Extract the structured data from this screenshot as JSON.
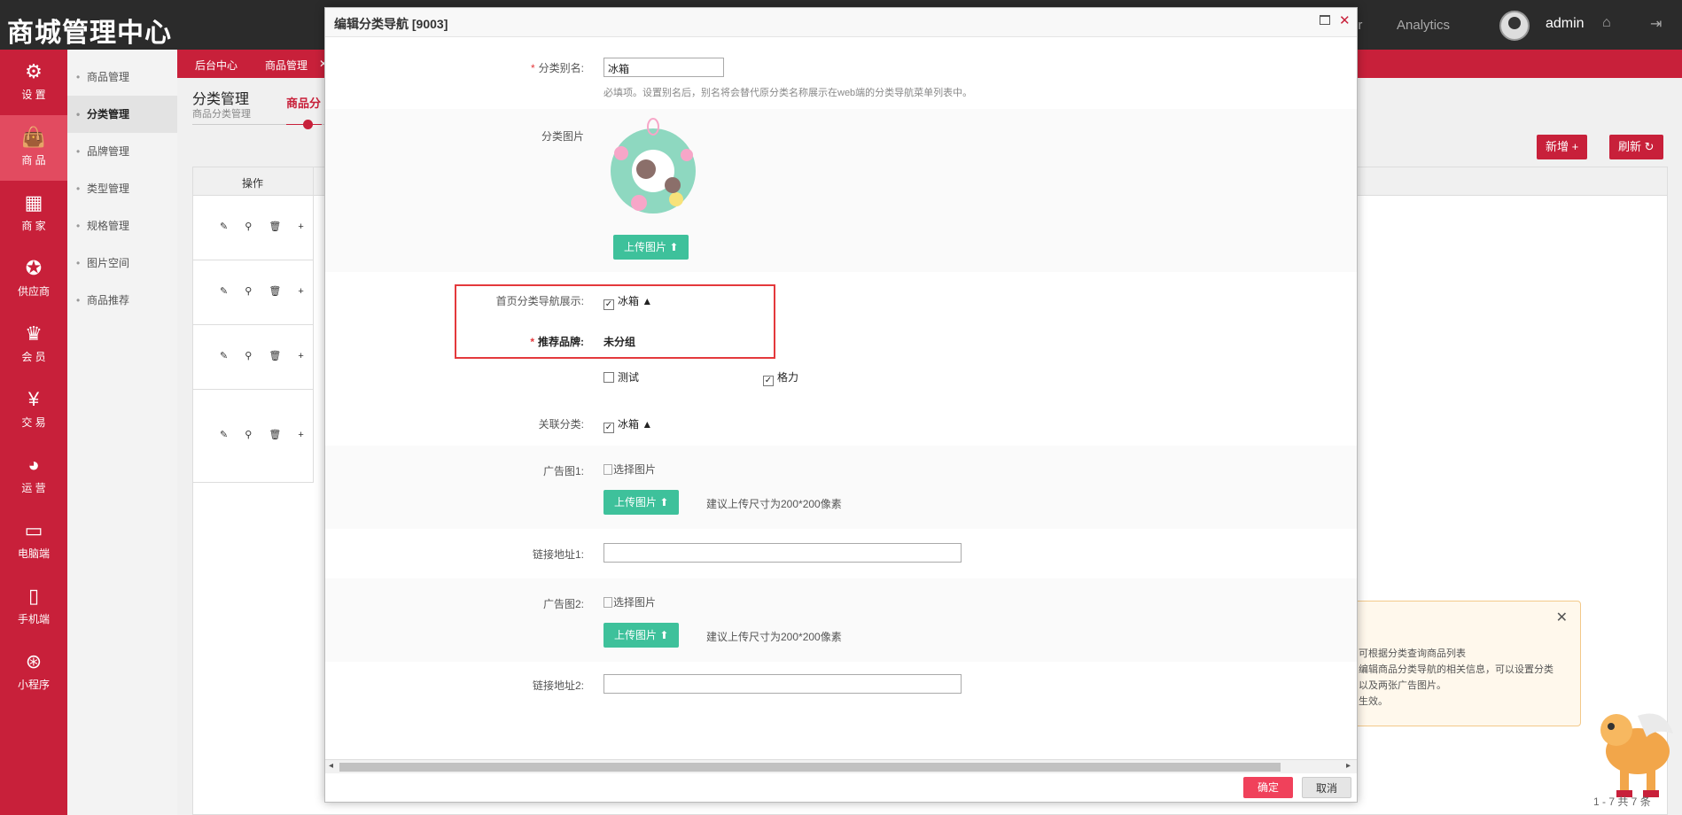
{
  "header": {
    "brand": "商城管理中心",
    "nav_partial": "er",
    "nav_analytics": "Analytics",
    "username": "admin"
  },
  "left_nav": [
    {
      "label": "设 置",
      "icon": "gear-icon",
      "glyph": "⚙"
    },
    {
      "label": "商 品",
      "icon": "bag-icon",
      "glyph": "👜"
    },
    {
      "label": "商 家",
      "icon": "store-icon",
      "glyph": "▦"
    },
    {
      "label": "供应商",
      "icon": "badge-icon",
      "glyph": "✪"
    },
    {
      "label": "会 员",
      "icon": "crown-icon",
      "glyph": "♛"
    },
    {
      "label": "交 易",
      "icon": "yen-icon",
      "glyph": "¥"
    },
    {
      "label": "运 营",
      "icon": "pie-icon",
      "glyph": "◕"
    },
    {
      "label": "电脑端",
      "icon": "monitor-icon",
      "glyph": "▭"
    },
    {
      "label": "手机端",
      "icon": "phone-icon",
      "glyph": "▯"
    },
    {
      "label": "小程序",
      "icon": "miniprogram-icon",
      "glyph": "⊛"
    }
  ],
  "sub_nav": [
    "商品管理",
    "分类管理",
    "品牌管理",
    "类型管理",
    "规格管理",
    "图片空间",
    "商品推荐"
  ],
  "breadcrumb": {
    "home": "后台中心",
    "item": "商品管理",
    "close": "✕"
  },
  "page": {
    "title": "分类管理",
    "subtitle": "商品分类管理",
    "tab": "商品分",
    "table_header": "操作",
    "add_button": "新增 +",
    "refresh_button": "刷新 ↻",
    "op_icons": "✎ ⚲ 🗑 +",
    "pager": "1 - 7 共 7 条"
  },
  "tip": {
    "lines": [
      "可根据分类查询商品列表",
      "编辑商品分类导航的相关信息，可以设置分类",
      "以及两张广告图片。",
      "生效。"
    ],
    "close": "✕"
  },
  "modal": {
    "title": "编辑分类导航 [9003]",
    "close": "✕",
    "alias_label": "分类别名:",
    "alias_value": "冰箱",
    "alias_hint": "必填项。设置别名后，别名将会替代原分类名称展示在web端的分类导航菜单列表中。",
    "image_label": "分类图片",
    "upload_label": "上传图片",
    "homepage_label": "首页分类导航展示:",
    "homepage_option": "冰箱 ▲",
    "brand_label": "推荐品牌:",
    "brand_group": "未分组",
    "brand_options": [
      "测试",
      "格力"
    ],
    "related_label": "关联分类:",
    "related_option": "冰箱 ▲",
    "ad1_label": "广告图1:",
    "select_image": "选择图片",
    "size_hint": "建议上传尺寸为200*200像素",
    "link1_label": "链接地址1:",
    "ad2_label": "广告图2:",
    "link2_label": "链接地址2:",
    "confirm": "确定",
    "cancel": "取消"
  },
  "colors": {
    "brand_red": "#c8203a",
    "upload_green": "#3ec19b",
    "confirm_red": "#f0415b"
  }
}
